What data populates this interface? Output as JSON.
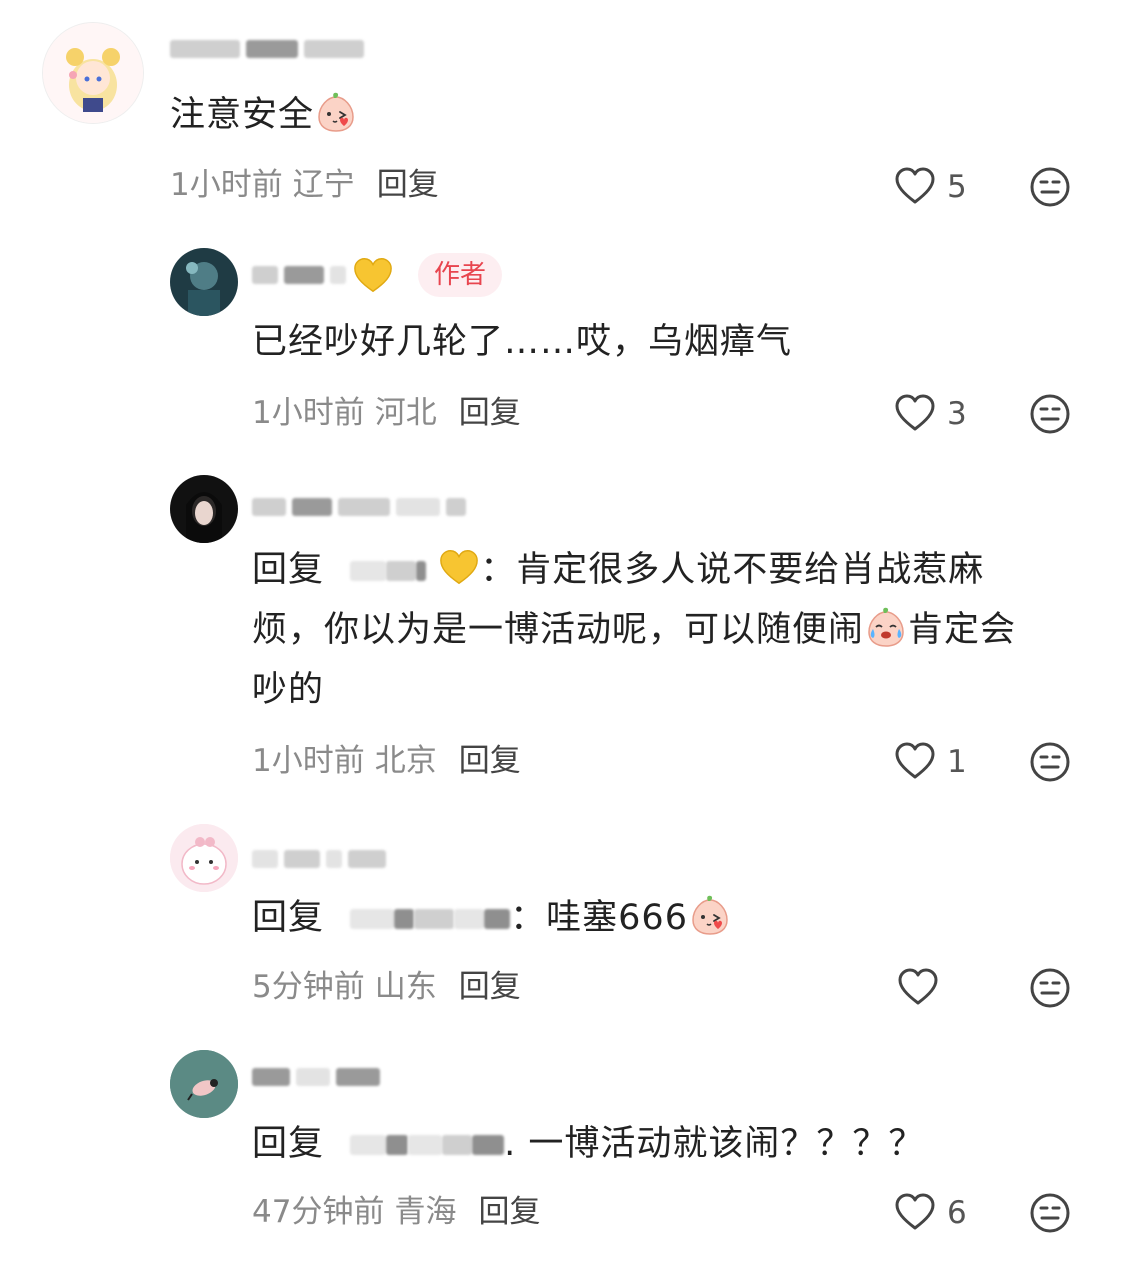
{
  "comments": [
    {
      "text": "注意安全",
      "time": "1小时前",
      "location": "辽宁",
      "reply_label": "回复",
      "likes": "5"
    },
    {
      "badge": "作者",
      "text": "已经吵好几轮了……哎，乌烟瘴气",
      "time": "1小时前",
      "location": "河北",
      "reply_label": "回复",
      "likes": "3"
    },
    {
      "reply_prefix": "回复",
      "text_a": "：肯定很多人说不要给肖战惹麻",
      "text_b": "烦，你以为是一博活动呢，可以随便闹",
      "text_c": "肯定会",
      "text_d": "吵的",
      "time": "1小时前",
      "location": "北京",
      "reply_label": "回复",
      "likes": "1"
    },
    {
      "reply_prefix": "回复",
      "text": "：哇塞666",
      "time": "5分钟前",
      "location": "山东",
      "reply_label": "回复",
      "likes": ""
    },
    {
      "reply_prefix": "回复",
      "text": ". 一博活动就该闹？？？？",
      "time": "47分钟前",
      "location": "青海",
      "reply_label": "回复",
      "likes": "6"
    }
  ],
  "icons": {
    "like": "heart-outline-icon",
    "dislike": "neutral-face-icon",
    "emoji_blush": "peach-kiss-emoji",
    "emoji_cry": "peach-laugh-cry-emoji",
    "emoji_heart": "yellow-heart-emoji"
  },
  "colors": {
    "badge_text": "#e8454f",
    "badge_bg": "#fdeef1",
    "meta_text": "#8a8a8a"
  }
}
